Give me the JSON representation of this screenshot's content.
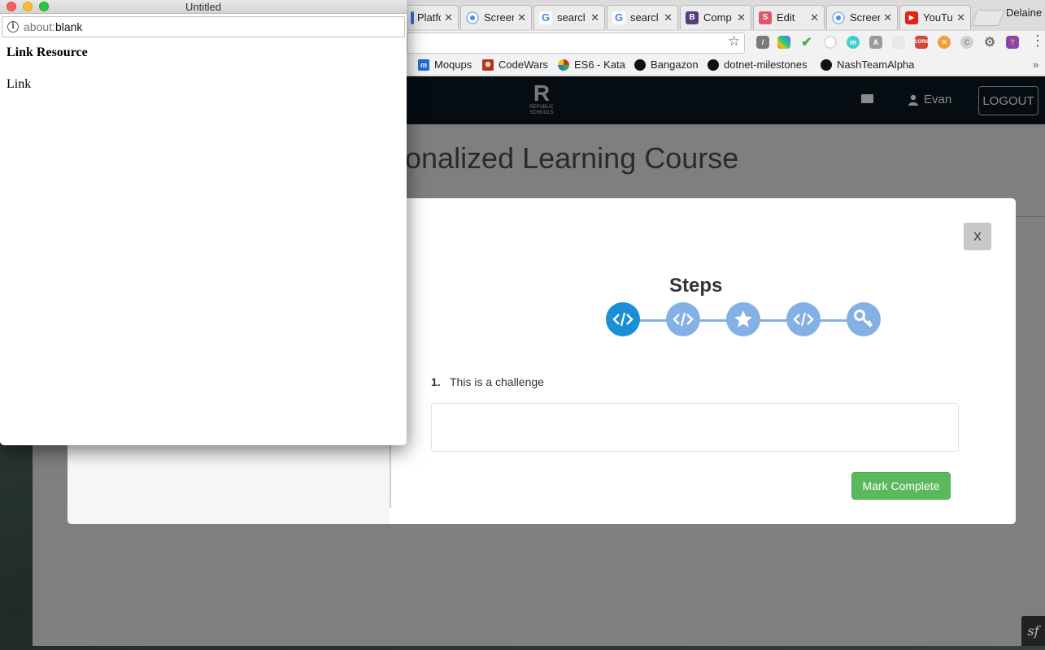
{
  "popup": {
    "title": "Untitled",
    "url_scheme": "about:",
    "url_rest": "blank",
    "heading": "Link Resource",
    "link": "Link"
  },
  "chrome": {
    "tabs": [
      {
        "label": "Platfor",
        "icon": "page-icon",
        "color": "#3b6bd6"
      },
      {
        "label": "Screer",
        "icon": "record-icon",
        "color": "#4a90e2"
      },
      {
        "label": "searcl",
        "icon": "google-icon",
        "color": "#4285f4"
      },
      {
        "label": "searcl",
        "icon": "google-icon",
        "color": "#4285f4"
      },
      {
        "label": "Comp",
        "icon": "bootstrap-icon",
        "color": "#563d7c"
      },
      {
        "label": "Edit",
        "icon": "s-icon",
        "color": "#e0556a"
      },
      {
        "label": "Screer",
        "icon": "record-icon",
        "color": "#4a90e2"
      },
      {
        "label": "YouTul",
        "icon": "youtube-icon",
        "color": "#e62117"
      }
    ],
    "profile_name": "Delaine",
    "bookmarks": [
      {
        "label": "Moqups",
        "icon": "moqups-icon",
        "color": "#1c6fd6"
      },
      {
        "label": "CodeWars",
        "icon": "codewars-icon",
        "color": "#b1361e"
      },
      {
        "label": "ES6 - Kata",
        "icon": "kata-icon",
        "color": "#c0392b"
      },
      {
        "label": "Bangazon",
        "icon": "github-icon",
        "color": "#111111"
      },
      {
        "label": "dotnet-milestones",
        "icon": "github-icon",
        "color": "#111111"
      },
      {
        "label": "NashTeamAlpha",
        "icon": "github-icon",
        "color": "#111111"
      }
    ],
    "more_bookmarks": "»"
  },
  "site": {
    "logo_letter": "R",
    "logo_sub1": "REPUBLIC",
    "logo_sub2": "SCHOOLS",
    "user": "Evan",
    "logout": "LOGOUT",
    "page_title": "sonalized Learning Course"
  },
  "modal": {
    "close": "X",
    "steps_title": "Steps",
    "steps": [
      {
        "icon": "code-icon",
        "active": true
      },
      {
        "icon": "code-icon",
        "active": false
      },
      {
        "icon": "star-icon",
        "active": false
      },
      {
        "icon": "code-icon",
        "active": false
      },
      {
        "icon": "key-icon",
        "active": false
      }
    ],
    "challenge_number": "1.",
    "challenge_text": "This is a challenge",
    "mark_complete": "Mark Complete"
  },
  "colors": {
    "step_active": "#1a8fd6",
    "step_inactive": "#85b0e6",
    "mark_complete": "#5cb85c"
  },
  "symfony_badge": "sf"
}
